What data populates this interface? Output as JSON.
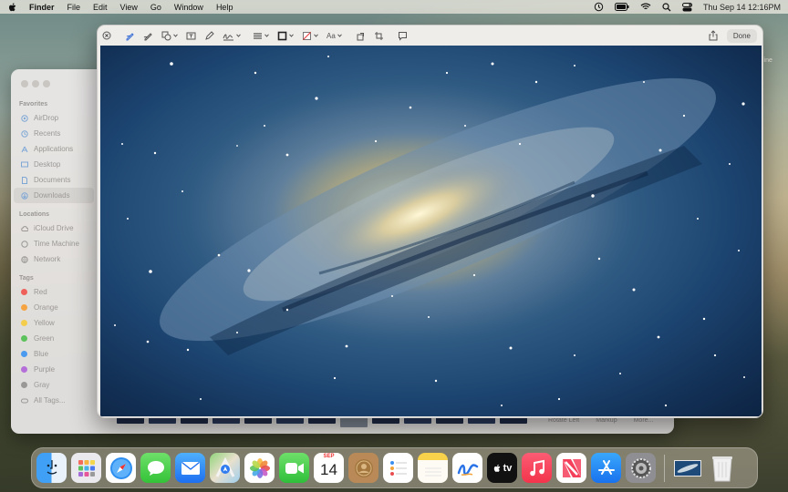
{
  "menubar": {
    "items": [
      "Finder",
      "File",
      "Edit",
      "View",
      "Go",
      "Window",
      "Help"
    ],
    "datetime": "Thu Sep 14  12:16PM"
  },
  "finder": {
    "favorites_header": "Favorites",
    "favorites": [
      "AirDrop",
      "Recents",
      "Applications",
      "Desktop",
      "Documents",
      "Downloads"
    ],
    "locations_header": "Locations",
    "locations": [
      "iCloud Drive",
      "Time Machine",
      "Network"
    ],
    "tags_header": "Tags",
    "tags": [
      {
        "label": "Red",
        "color": "#f0605a"
      },
      {
        "label": "Orange",
        "color": "#f5a441"
      },
      {
        "label": "Yellow",
        "color": "#f3cd4b"
      },
      {
        "label": "Green",
        "color": "#5cc25b"
      },
      {
        "label": "Blue",
        "color": "#4a9af0"
      },
      {
        "label": "Purple",
        "color": "#b56fd8"
      },
      {
        "label": "Gray",
        "color": "#9a9896"
      },
      {
        "label": "All Tags...",
        "color": ""
      }
    ],
    "actions": [
      "Rotate Left",
      "Markup",
      "More..."
    ]
  },
  "preview": {
    "done_label": "Done",
    "text_tool_label": "Aa"
  },
  "dock": {
    "calendar_month": "SEP",
    "calendar_day": "14",
    "tv_label": "tv",
    "apps": [
      "Finder",
      "Launchpad",
      "Safari",
      "Messages",
      "Mail",
      "Maps",
      "Photos",
      "FaceTime",
      "Calendar",
      "Contacts",
      "Reminders",
      "Notes",
      "Freeform",
      "TV",
      "Music",
      "News",
      "App Store",
      "System Settings",
      "Wallpaper",
      "Trash"
    ]
  },
  "desktop_label_fragment": "line"
}
